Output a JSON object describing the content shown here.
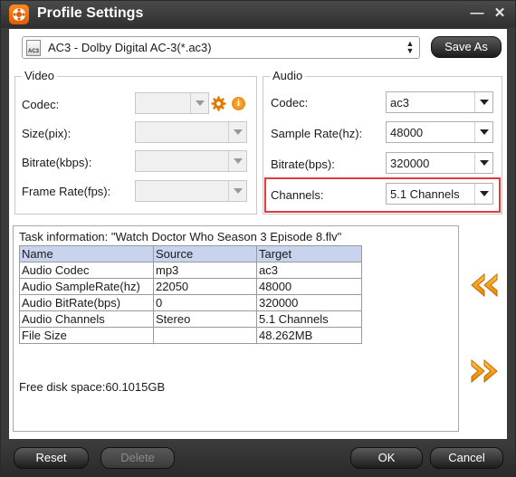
{
  "window": {
    "title": "Profile Settings",
    "minimize_glyph": "—",
    "close_glyph": "✕",
    "accent_color": "#f07a10",
    "highlight_color": "#e03c3c"
  },
  "profile": {
    "selected": "AC3 - Dolby Digital AC-3(*.ac3)",
    "icon_text": "AC3",
    "save_as_label": "Save As"
  },
  "video": {
    "title": "Video",
    "codec_label": "Codec:",
    "size_label": "Size(pix):",
    "bitrate_label": "Bitrate(kbps):",
    "framerate_label": "Frame Rate(fps):",
    "codec_value": "",
    "size_value": "",
    "bitrate_value": "",
    "framerate_value": ""
  },
  "audio": {
    "title": "Audio",
    "codec_label": "Codec:",
    "codec_value": "ac3",
    "samplerate_label": "Sample Rate(hz):",
    "samplerate_value": "48000",
    "bitrate_label": "Bitrate(bps):",
    "bitrate_value": "320000",
    "channels_label": "Channels:",
    "channels_value": "5.1 Channels"
  },
  "task": {
    "info_line": "Task information: \"Watch Doctor Who Season 3 Episode 8.flv\"",
    "headers": [
      "Name",
      "Source",
      "Target"
    ],
    "rows": [
      [
        "Audio Codec",
        "mp3",
        "ac3"
      ],
      [
        "Audio SampleRate(hz)",
        "22050",
        "48000"
      ],
      [
        "Audio BitRate(bps)",
        "0",
        "320000"
      ],
      [
        "Audio Channels",
        "Stereo",
        "5.1 Channels"
      ],
      [
        "File Size",
        "",
        "48.262MB"
      ]
    ],
    "free_space": "Free disk space:60.1015GB"
  },
  "buttons": {
    "reset": "Reset",
    "delete": "Delete",
    "ok": "OK",
    "cancel": "Cancel"
  },
  "icons": {
    "app": "app-logo-icon",
    "gear": "gear-icon",
    "info": "info-icon",
    "prev": "rewind-icon",
    "next": "fast-forward-icon"
  }
}
